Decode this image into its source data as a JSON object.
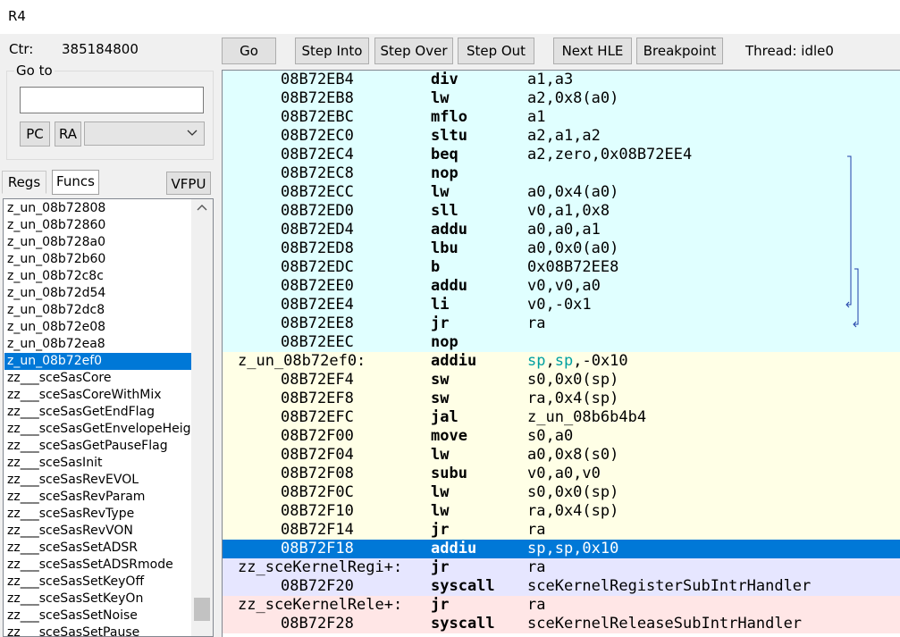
{
  "window": {
    "title": "R4"
  },
  "ctr": {
    "label": "Ctr:",
    "value": "385184800"
  },
  "goto": {
    "label": "Go to",
    "input_value": "",
    "pc_label": "PC",
    "ra_label": "RA",
    "select_value": ""
  },
  "tabs": {
    "regs": "Regs",
    "funcs": "Funcs",
    "vfpu": "VFPU"
  },
  "functions": [
    "z_un_08b72808",
    "z_un_08b72860",
    "z_un_08b728a0",
    "z_un_08b72b60",
    "z_un_08b72c8c",
    "z_un_08b72d54",
    "z_un_08b72dc8",
    "z_un_08b72e08",
    "z_un_08b72ea8",
    "z_un_08b72ef0",
    "zz___sceSasCore",
    "zz___sceSasCoreWithMix",
    "zz___sceSasGetEndFlag",
    "zz___sceSasGetEnvelopeHeig",
    "zz___sceSasGetPauseFlag",
    "zz___sceSasInit",
    "zz___sceSasRevEVOL",
    "zz___sceSasRevParam",
    "zz___sceSasRevType",
    "zz___sceSasRevVON",
    "zz___sceSasSetADSR",
    "zz___sceSasSetADSRmode",
    "zz___sceSasSetKeyOff",
    "zz___sceSasSetKeyOn",
    "zz___sceSasSetNoise",
    "zz___sceSasSetPause"
  ],
  "selected_function_index": 9,
  "toolbar": {
    "go": "Go",
    "step_into": "Step Into",
    "step_over": "Step Over",
    "step_out": "Step Out",
    "next_hle": "Next HLE",
    "breakpoint": "Breakpoint",
    "thread": "Thread: idle0"
  },
  "disassembly": [
    {
      "addr": "08B72EB4",
      "label": "",
      "op": "div",
      "args": "a1,a3",
      "bg": "cyan"
    },
    {
      "addr": "08B72EB8",
      "label": "",
      "op": "lw",
      "args": "a2,0x8(a0)",
      "bg": "cyan"
    },
    {
      "addr": "08B72EBC",
      "label": "",
      "op": "mflo",
      "args": "a1",
      "bg": "cyan"
    },
    {
      "addr": "08B72EC0",
      "label": "",
      "op": "sltu",
      "args": "a2,a1,a2",
      "bg": "cyan"
    },
    {
      "addr": "08B72EC4",
      "label": "",
      "op": "beq",
      "args": "a2,zero,0x08B72EE4",
      "bg": "cyan"
    },
    {
      "addr": "08B72EC8",
      "label": "",
      "op": "nop",
      "args": "",
      "bg": "cyan"
    },
    {
      "addr": "08B72ECC",
      "label": "",
      "op": "lw",
      "args": "a0,0x4(a0)",
      "bg": "cyan"
    },
    {
      "addr": "08B72ED0",
      "label": "",
      "op": "sll",
      "args": "v0,a1,0x8",
      "bg": "cyan"
    },
    {
      "addr": "08B72ED4",
      "label": "",
      "op": "addu",
      "args": "a0,a0,a1",
      "bg": "cyan"
    },
    {
      "addr": "08B72ED8",
      "label": "",
      "op": "lbu",
      "args": "a0,0x0(a0)",
      "bg": "cyan"
    },
    {
      "addr": "08B72EDC",
      "label": "",
      "op": "b",
      "args": "0x08B72EE8",
      "bg": "cyan"
    },
    {
      "addr": "08B72EE0",
      "label": "",
      "op": "addu",
      "args": "v0,v0,a0",
      "bg": "cyan"
    },
    {
      "addr": "08B72EE4",
      "label": "",
      "op": "li",
      "args": "v0,-0x1",
      "bg": "cyan"
    },
    {
      "addr": "08B72EE8",
      "label": "",
      "op": "jr",
      "args": "ra",
      "bg": "cyan"
    },
    {
      "addr": "08B72EEC",
      "label": "",
      "op": "nop",
      "args": "",
      "bg": "cyan"
    },
    {
      "addr": "",
      "label": "z_un_08b72ef0:",
      "op": "addiu",
      "args": "sp,sp,-0x10",
      "bg": "yellow",
      "highlight_regs": true
    },
    {
      "addr": "08B72EF4",
      "label": "",
      "op": "sw",
      "args": "s0,0x0(sp)",
      "bg": "yellow"
    },
    {
      "addr": "08B72EF8",
      "label": "",
      "op": "sw",
      "args": "ra,0x4(sp)",
      "bg": "yellow"
    },
    {
      "addr": "08B72EFC",
      "label": "",
      "op": "jal",
      "args": "z_un_08b6b4b4",
      "bg": "yellow"
    },
    {
      "addr": "08B72F00",
      "label": "",
      "op": "move",
      "args": "s0,a0",
      "bg": "yellow"
    },
    {
      "addr": "08B72F04",
      "label": "",
      "op": "lw",
      "args": "a0,0x8(s0)",
      "bg": "yellow"
    },
    {
      "addr": "08B72F08",
      "label": "",
      "op": "subu",
      "args": "v0,a0,v0",
      "bg": "yellow"
    },
    {
      "addr": "08B72F0C",
      "label": "",
      "op": "lw",
      "args": "s0,0x0(sp)",
      "bg": "yellow"
    },
    {
      "addr": "08B72F10",
      "label": "",
      "op": "lw",
      "args": "ra,0x4(sp)",
      "bg": "yellow"
    },
    {
      "addr": "08B72F14",
      "label": "",
      "op": "jr",
      "args": "ra",
      "bg": "yellow"
    },
    {
      "addr": "08B72F18",
      "label": "",
      "op": "addiu",
      "args": "sp,sp,0x10",
      "bg": "sel"
    },
    {
      "addr": "",
      "label": "zz_sceKernelRegi+:",
      "op": "jr",
      "args": "ra",
      "bg": "lav"
    },
    {
      "addr": "08B72F20",
      "label": "",
      "op": "syscall",
      "args": "sceKernelRegisterSubIntrHandler",
      "bg": "lav"
    },
    {
      "addr": "",
      "label": "zz_sceKernelRele+:",
      "op": "jr",
      "args": "ra",
      "bg": "pink"
    },
    {
      "addr": "08B72F28",
      "label": "",
      "op": "syscall",
      "args": "sceKernelReleaseSubIntrHandler",
      "bg": "pink"
    }
  ]
}
